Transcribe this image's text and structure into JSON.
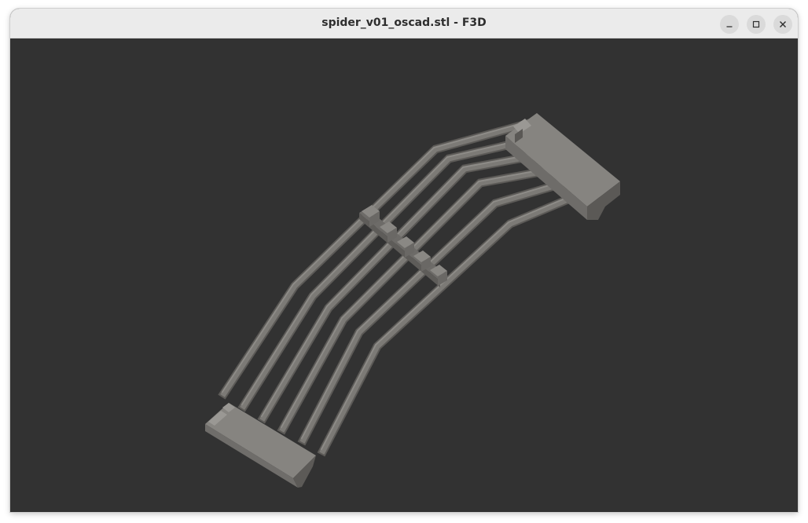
{
  "window": {
    "title": "spider_v01_oscad.stl - F3D"
  },
  "titlebar_buttons": [
    {
      "name": "minimize",
      "icon": "minimize-icon"
    },
    {
      "name": "maximize",
      "icon": "maximize-icon"
    },
    {
      "name": "close",
      "icon": "close-icon"
    }
  ],
  "colors": {
    "viewport_background": "#323232",
    "model_face": "#7c7a76",
    "model_face_light": "#8a8884",
    "model_face_dark": "#5f5d5a",
    "titlebar": "#ebebeb"
  }
}
